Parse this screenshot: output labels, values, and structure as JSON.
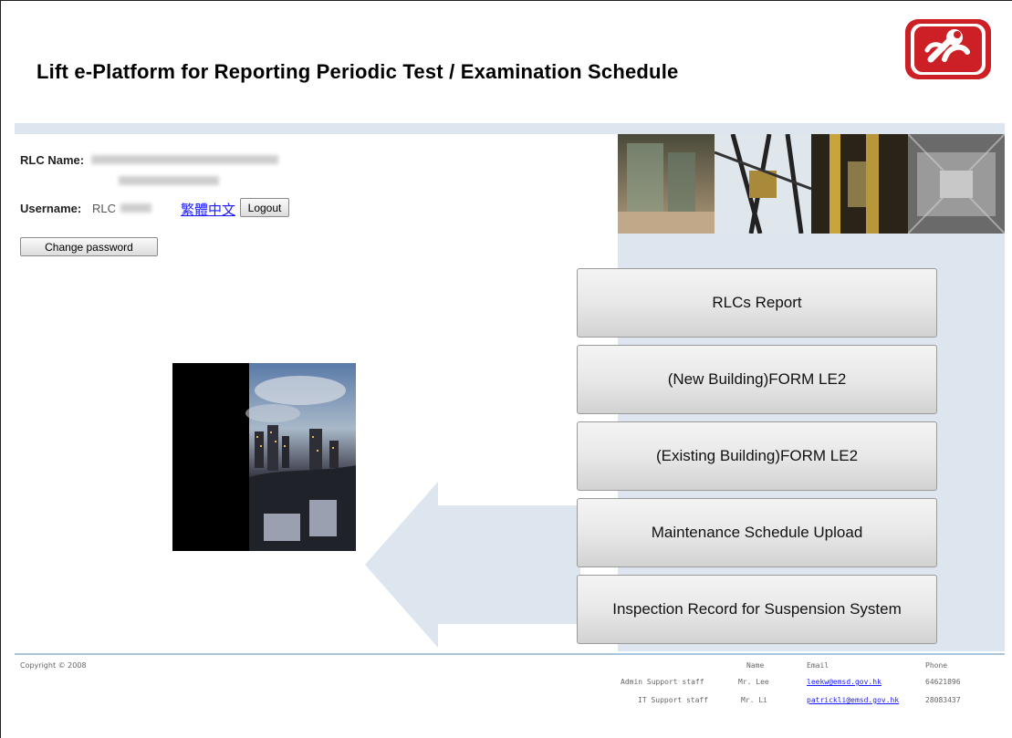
{
  "header": {
    "title": "Lift e-Platform for Reporting Periodic Test / Examination Schedule",
    "logo_icon": "emsd-wrench-logo-icon",
    "logo_color": "#cc1f26"
  },
  "user": {
    "rlc_name_label": "RLC Name:",
    "username_label": "Username:",
    "username_value": "RLC",
    "language_link": "繁體中文",
    "logout_label": "Logout",
    "change_password_label": "Change password"
  },
  "menu": {
    "items": [
      {
        "label": "RLCs Report"
      },
      {
        "label": "(New Building)FORM LE2"
      },
      {
        "label": "(Existing Building)FORM LE2"
      },
      {
        "label": "Maintenance Schedule Upload"
      },
      {
        "label": "Inspection Record for Suspension System"
      }
    ]
  },
  "footer": {
    "copyright": "Copyright © 2008",
    "headers": {
      "name": "Name",
      "email": "Email",
      "phone": "Phone"
    },
    "contacts": [
      {
        "role": "Admin Support staff",
        "name": "Mr. Lee",
        "email": "leekw@emsd.gov.hk",
        "phone": "64621896"
      },
      {
        "role": "IT Support staff",
        "name": "Mr. Li",
        "email": "patrickli@emsd.gov.hk",
        "phone": "28083437"
      }
    ]
  },
  "colors": {
    "accent_band": "#dde6ee",
    "link": "#1a1aff"
  }
}
